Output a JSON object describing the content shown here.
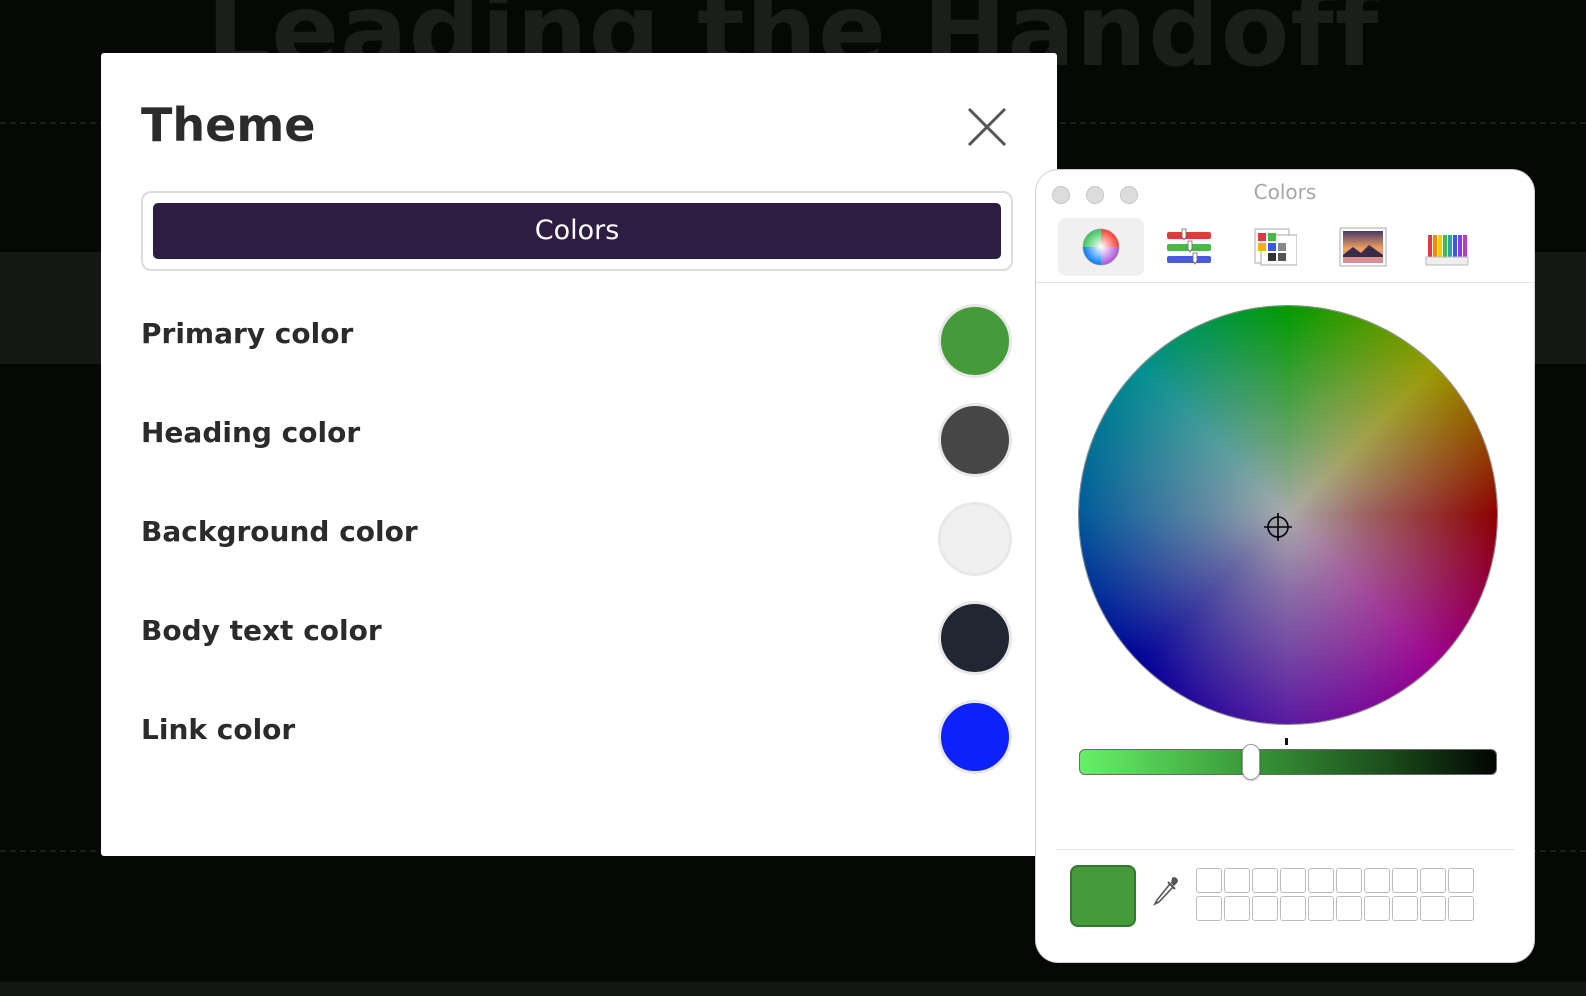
{
  "background": {
    "title": "Leading the Handoff"
  },
  "theme_modal": {
    "title": "Theme",
    "active_tab": "Colors",
    "colors": [
      {
        "label": "Primary color",
        "value": "#459b39"
      },
      {
        "label": "Heading color",
        "value": "#464646"
      },
      {
        "label": "Background color",
        "value": "#f0f0f0"
      },
      {
        "label": "Body text color",
        "value": "#212633"
      },
      {
        "label": "Link color",
        "value": "#0d22fb"
      }
    ]
  },
  "color_panel": {
    "title": "Colors",
    "modes": [
      "color-wheel-icon",
      "color-sliders-icon",
      "color-palettes-icon",
      "image-palettes-icon",
      "pencils-icon"
    ],
    "active_mode": "color-wheel-icon",
    "current_color": "#459b39",
    "brightness_percent": 41,
    "swatch_wells": 20
  }
}
